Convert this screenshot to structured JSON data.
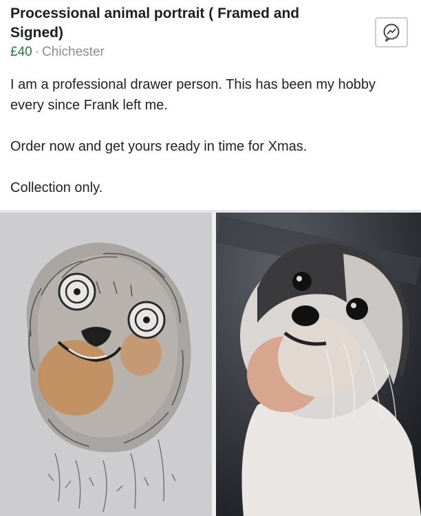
{
  "listing": {
    "title": "Processional animal portrait ( Framed and Signed)",
    "price": "£40",
    "separator": "·",
    "location": "Chichester",
    "message_icon": "messenger-icon",
    "description": [
      "I am a professional drawer person. This has been my hobby  every since Frank left me.",
      "Order now and get yours ready in time for Xmas.",
      "Collection only."
    ]
  },
  "photos": [
    {
      "name": "drawing-photo"
    },
    {
      "name": "dog-photo"
    }
  ]
}
